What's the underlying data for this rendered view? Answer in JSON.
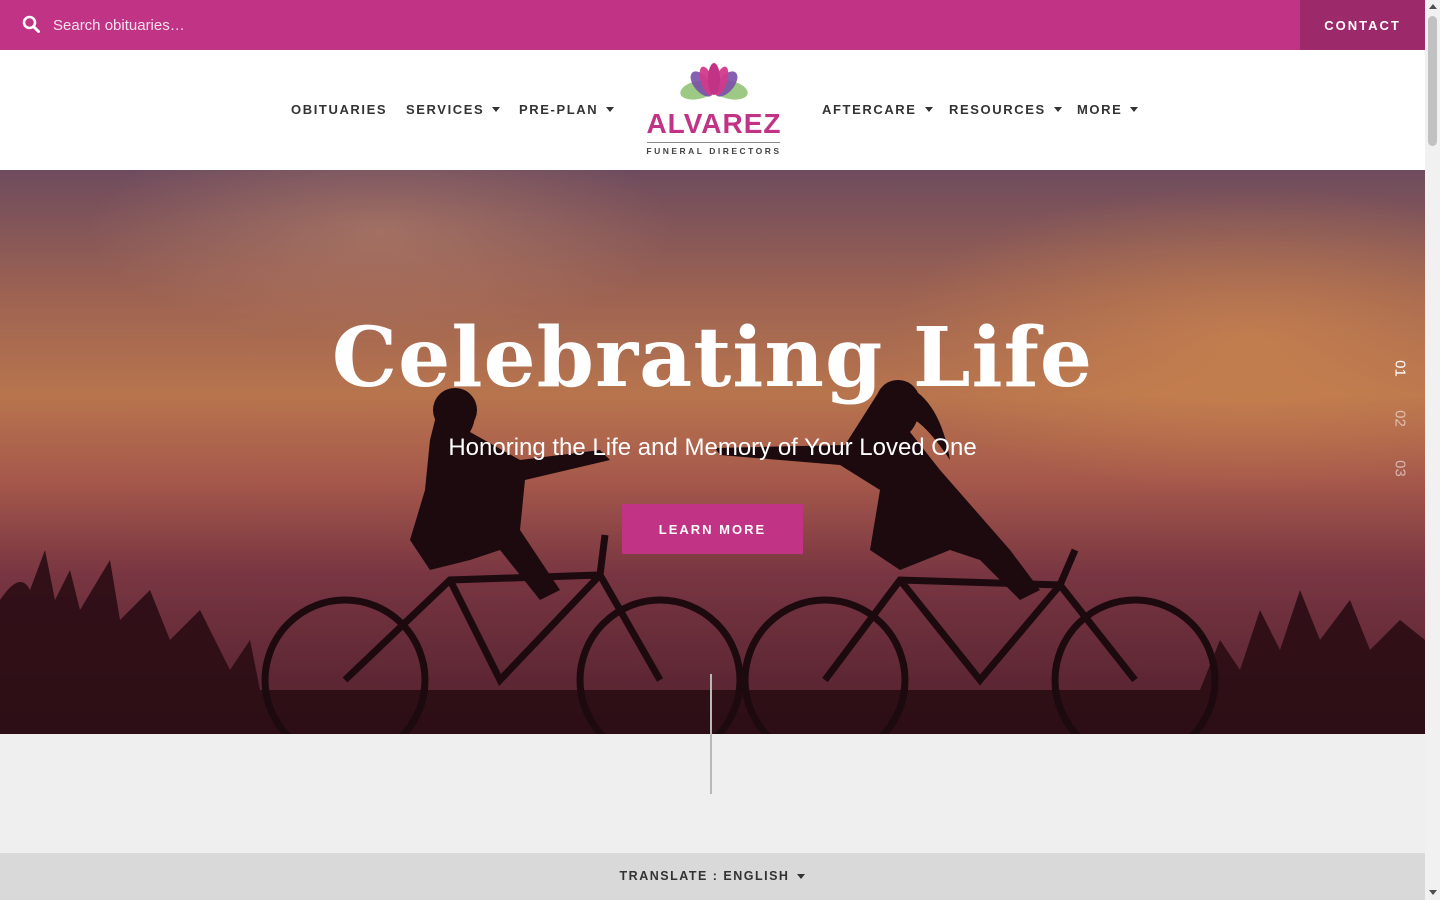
{
  "topbar": {
    "search_placeholder": "Search obituaries…",
    "contact_label": "CONTACT",
    "icon": "search-icon"
  },
  "nav": {
    "left": [
      {
        "label": "OBITUARIES",
        "has_dropdown": false
      },
      {
        "label": "SERVICES",
        "has_dropdown": true
      },
      {
        "label": "PRE-PLAN",
        "has_dropdown": true
      }
    ],
    "right": [
      {
        "label": "AFTERCARE",
        "has_dropdown": true
      },
      {
        "label": "RESOURCES",
        "has_dropdown": true
      },
      {
        "label": "MORE",
        "has_dropdown": true
      }
    ]
  },
  "logo": {
    "name": "ALVAREZ",
    "subtitle": "FUNERAL DIRECTORS"
  },
  "hero": {
    "title": "Celebrating Life",
    "subtitle": "Honoring the Life and Memory of Your Loved One",
    "button_label": "LEARN MORE",
    "slides": [
      "01",
      "02",
      "03"
    ],
    "active_slide": "01"
  },
  "footer_bar": {
    "translate_label": "TRANSLATE : ENGLISH"
  },
  "colors": {
    "brand": "#c13385",
    "brand_dark": "#9c2a6b",
    "translate_bar": "#d9d9d9",
    "page_bg": "#efefef"
  }
}
